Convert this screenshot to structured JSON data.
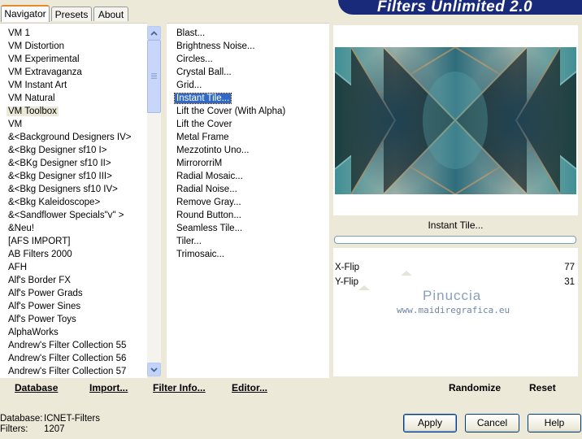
{
  "tabs": [
    {
      "label": "Navigator",
      "active": true
    },
    {
      "label": "Presets",
      "active": false
    },
    {
      "label": "About",
      "active": false
    }
  ],
  "banner": {
    "title": "Filters Unlimited 2.0"
  },
  "categories": {
    "items": [
      "VM 1",
      "VM Distortion",
      "VM Experimental",
      "VM Extravaganza",
      "VM Instant Art",
      "VM Natural",
      "VM Toolbox",
      "VM",
      "&<Background Designers IV>",
      "&<Bkg Designer sf10 I>",
      "&<BKg Designer sf10 II>",
      "&<Bkg Designer sf10 III>",
      "&<Bkg Designers sf10 IV>",
      "&<Bkg Kaleidoscope>",
      "&<Sandflower Specials\"v\" >",
      "&Neu!",
      "[AFS IMPORT]",
      "AB Filters 2000",
      "AFH",
      "Alf's Border FX",
      "Alf's Power Grads",
      "Alf's Power Sines",
      "Alf's Power Toys",
      "AlphaWorks",
      "Andrew's Filter Collection 55",
      "Andrew's Filter Collection 56",
      "Andrew's Filter Collection 57"
    ],
    "selected_index": 6
  },
  "filters": {
    "items": [
      "Blast...",
      "Brightness Noise...",
      "Circles...",
      "Crystal Ball...",
      "Grid...",
      "Instant Tile...",
      "Lift the Cover (With Alpha)",
      "Lift the Cover",
      "Metal Frame",
      "Mezzotinto Uno...",
      "MirrororriM",
      "Radial Mosaic...",
      "Radial Noise...",
      "Remove Gray...",
      "Round Button...",
      "Seamless Tile...",
      "Tiler...",
      "Trimosaic..."
    ],
    "selected_index": 5
  },
  "left_toolbar": {
    "database": "Database",
    "import": "Import...",
    "filter_info": "Filter Info...",
    "editor": "Editor..."
  },
  "preview": {
    "filter_name": "Instant Tile..."
  },
  "params": [
    {
      "label": "X-Flip",
      "value": "77"
    },
    {
      "label": "Y-Flip",
      "value": "31"
    }
  ],
  "watermark": {
    "name": "Pinuccia",
    "site": "www.maidiregrafica.eu"
  },
  "right_toolbar": {
    "randomize": "Randomize",
    "reset": "Reset"
  },
  "status": {
    "database_label": "Database:",
    "database_value": "ICNET-Filters",
    "filters_label": "Filters:",
    "filters_value": "1207"
  },
  "buttons": {
    "apply": "Apply",
    "cancel": "Cancel",
    "help": "Help"
  },
  "colors": {
    "banner": "#1a2a7a",
    "selection": "#316ac5",
    "window": "#ece9d8"
  }
}
